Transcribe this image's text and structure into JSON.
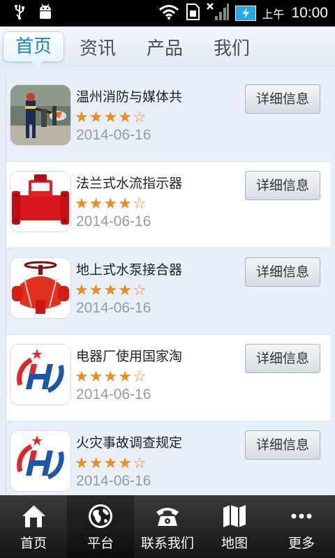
{
  "status": {
    "ampm": "上午",
    "time": "10:00"
  },
  "tabs": [
    {
      "label": "首页",
      "active": true
    },
    {
      "label": "资讯",
      "active": false
    },
    {
      "label": "产品",
      "active": false
    },
    {
      "label": "我们",
      "active": false
    }
  ],
  "items": [
    {
      "title": "温州消防与媒体共",
      "rating": 4,
      "max_rating": 5,
      "date": "2014-06-16",
      "button": "详细信息",
      "thumb": "firefighter-photo"
    },
    {
      "title": "法兰式水流指示器",
      "rating": 4,
      "max_rating": 5,
      "date": "2014-06-16",
      "button": "详细信息",
      "thumb": "red-flange-valve"
    },
    {
      "title": "地上式水泵接合器",
      "rating": 4,
      "max_rating": 5,
      "date": "2014-06-16",
      "button": "详细信息",
      "thumb": "red-hydrant-connector"
    },
    {
      "title": "电器厂使用国家淘",
      "rating": 4,
      "max_rating": 5,
      "date": "2014-06-16",
      "button": "详细信息",
      "thumb": "company-logo"
    },
    {
      "title": "火灾事故调查规定",
      "rating": 4,
      "max_rating": 5,
      "date": "2014-06-16",
      "button": "详细信息",
      "thumb": "company-logo"
    }
  ],
  "bottom_nav": [
    {
      "label": "首页",
      "icon": "home-icon",
      "active": false
    },
    {
      "label": "平台",
      "icon": "globe-icon",
      "active": true
    },
    {
      "label": "联系我们",
      "icon": "phone-icon",
      "active": false
    },
    {
      "label": "地图",
      "icon": "map-icon",
      "active": false
    },
    {
      "label": "更多",
      "icon": "more-icon",
      "active": false
    }
  ],
  "colors": {
    "accent": "#1b7fd0",
    "star": "#f18a1b",
    "logo_red": "#e2252b",
    "logo_blue": "#1a57a8"
  }
}
